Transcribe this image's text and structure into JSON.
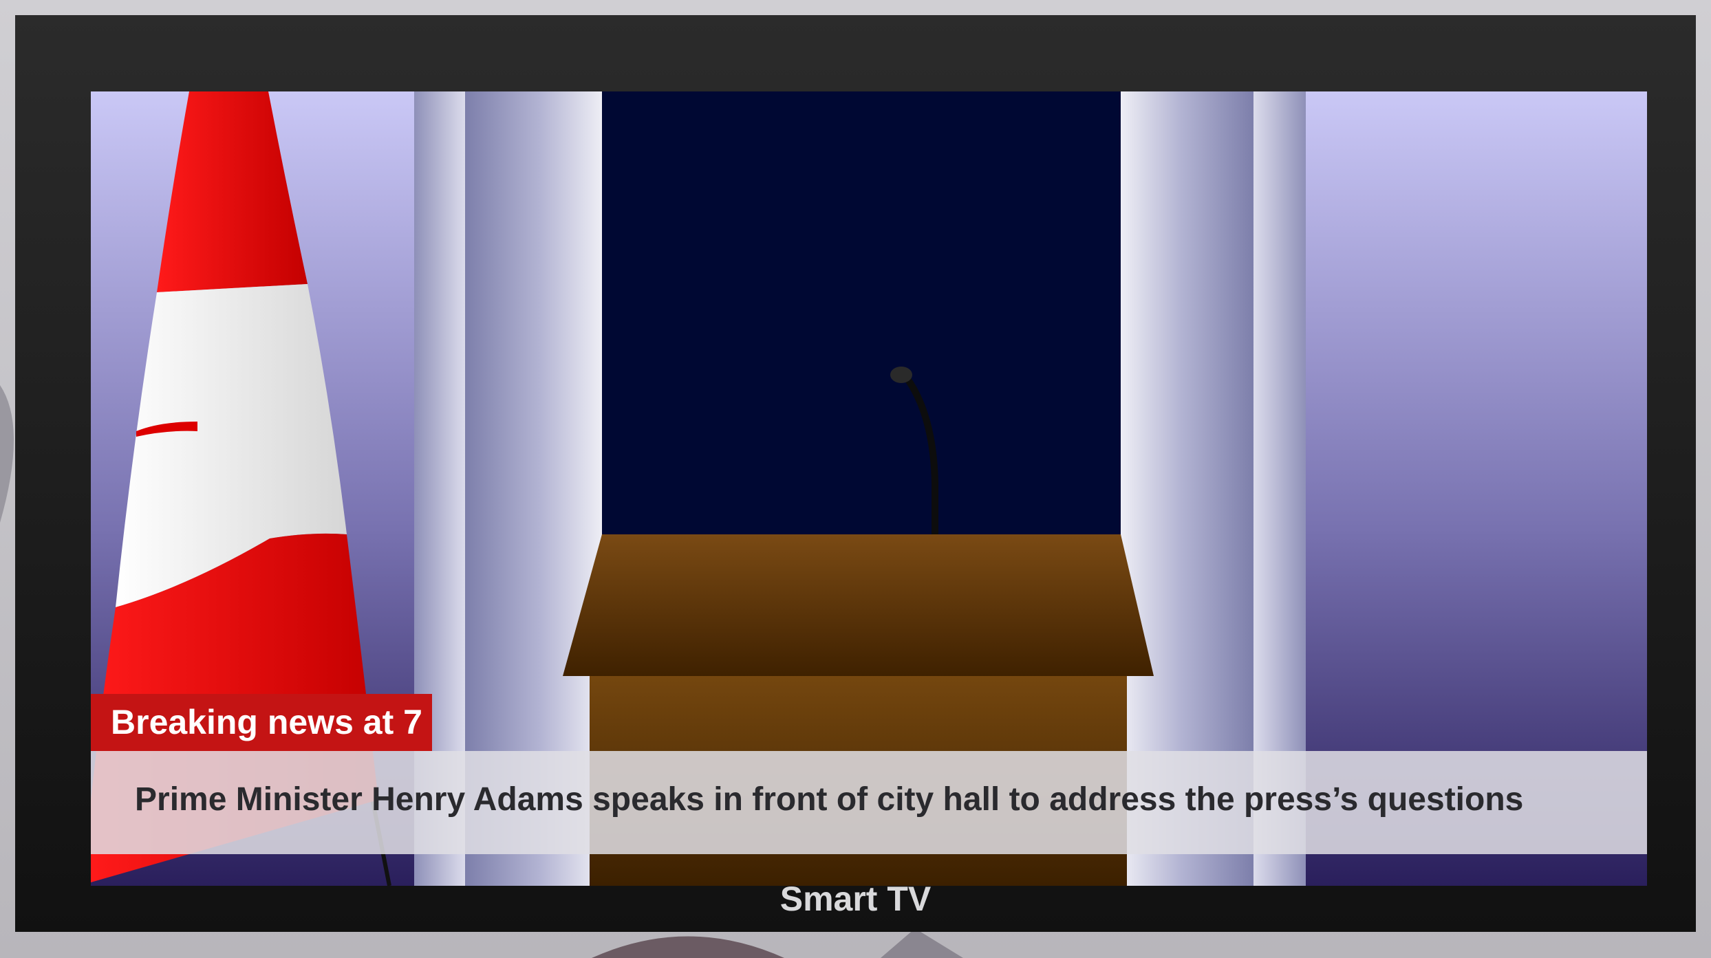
{
  "tv": {
    "brand_label": "Smart TV"
  },
  "broadcast": {
    "headline_tag": "Breaking news at 7",
    "ticker_text": "Prime Minister Henry Adams speaks in front of city hall to address the press’s questions"
  },
  "colors": {
    "tag_red": "#c41414",
    "flag_red": "#e00000",
    "podium_brown": "#6b3f0e",
    "backdrop_navy": "#000833",
    "wall_lavender": "#c9c6f5"
  }
}
